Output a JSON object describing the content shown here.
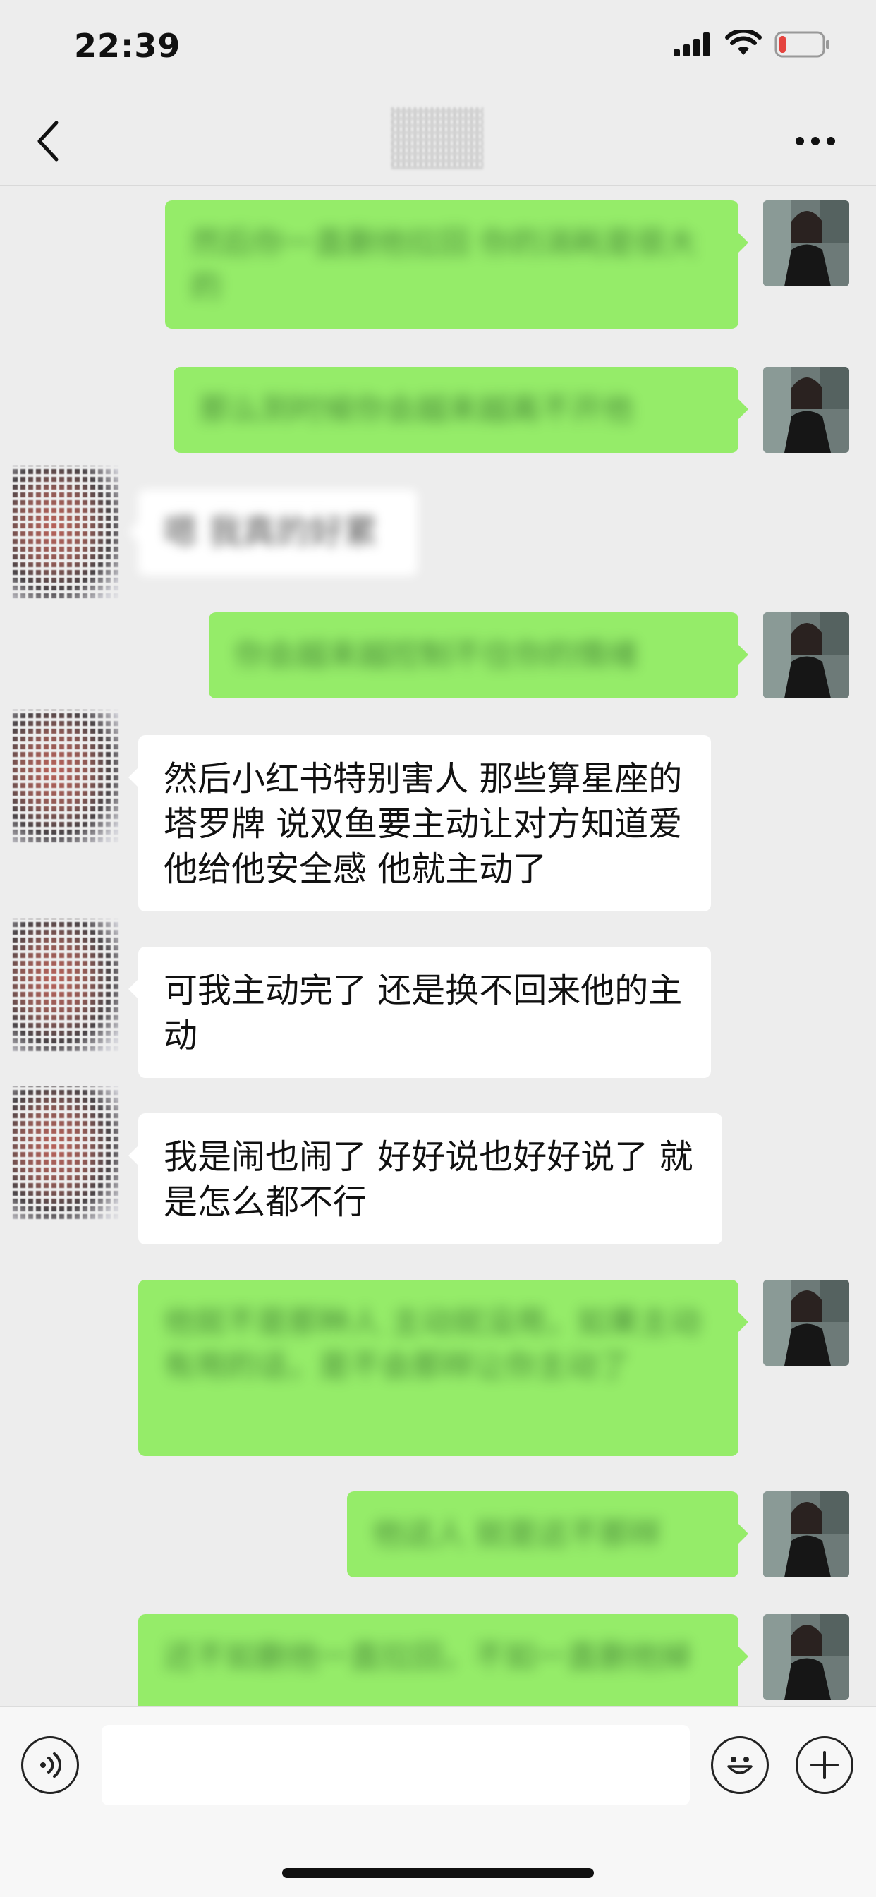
{
  "status_bar": {
    "time": "22:39",
    "battery_level": 0.15,
    "battery_color": "#e5443f"
  },
  "nav": {
    "back_icon": "chevron-left-icon",
    "more_icon": "more-dots-icon"
  },
  "messages": [
    {
      "sender": "me",
      "text": "然后你一直删他拉回 你的消耗是很大的",
      "blurred": true
    },
    {
      "sender": "me",
      "text": "那么到时候你会越来越离不开他",
      "blurred": true
    },
    {
      "sender": "other",
      "text": "嗯 我真的好累",
      "blurred": true
    },
    {
      "sender": "me",
      "text": "你会越来越控制不住你的情绪",
      "blurred": true
    },
    {
      "sender": "other",
      "text": "然后小红书特别害人 那些算星座的塔罗牌 说双鱼要主动让对方知道爱他给他安全感 他就主动了",
      "blurred": false
    },
    {
      "sender": "other",
      "text": "可我主动完了 还是换不回来他的主动",
      "blurred": false
    },
    {
      "sender": "other",
      "text": "我是闹也闹了 好好说也好好说了 就是怎么都不行",
      "blurred": false
    },
    {
      "sender": "me",
      "text": "他就不是那种人 主动就没用，如果主动有用的话，是不会那样让你主动了",
      "blurred": true
    },
    {
      "sender": "me",
      "text": "他这人 就是这不那样",
      "blurred": true
    },
    {
      "sender": "me",
      "text": "还不如删他一直拉回，不如一直删他掉",
      "blurred": true
    }
  ],
  "colors": {
    "my_bubble": "#95ec69",
    "other_bubble": "#ffffff",
    "background": "#ededed"
  },
  "input_bar": {
    "voice_icon": "voice-icon",
    "emoji_icon": "emoji-icon",
    "plus_icon": "plus-icon",
    "text_value": ""
  }
}
